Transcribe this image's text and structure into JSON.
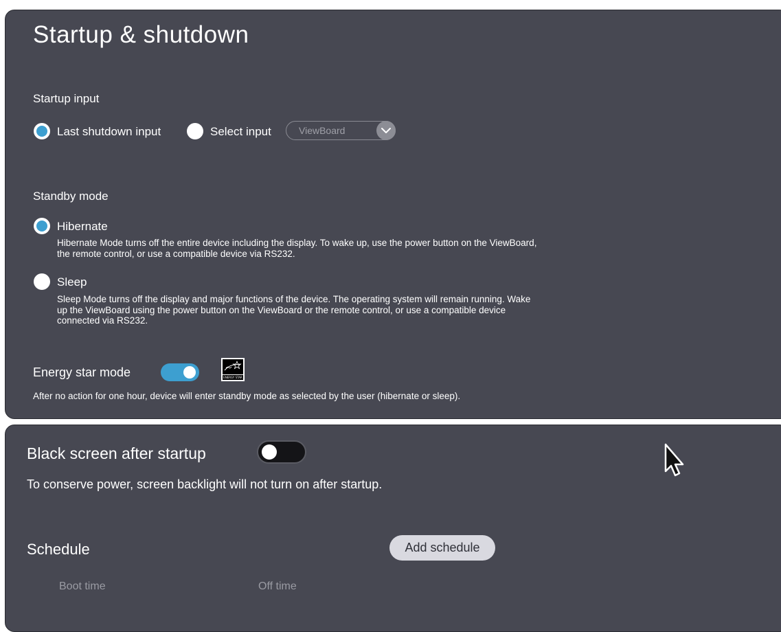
{
  "header": {
    "title": "Startup & shutdown"
  },
  "startup_input": {
    "label": "Startup input",
    "options": [
      {
        "label": "Last shutdown input",
        "selected": true
      },
      {
        "label": "Select input",
        "selected": false
      }
    ],
    "select": {
      "value": "ViewBoard"
    }
  },
  "standby_mode": {
    "label": "Standby mode",
    "options": [
      {
        "label": "Hibernate",
        "selected": true,
        "description": "Hibernate Mode turns off the entire device including the display. To wake up, use the power button on the ViewBoard, the remote control, or use a compatible device via RS232."
      },
      {
        "label": "Sleep",
        "selected": false,
        "description": "Sleep Mode turns off the display and major functions of the device. The operating system will remain running. Wake up the ViewBoard using the power button on the ViewBoard or the remote control, or use a compatible device connected via RS232."
      }
    ]
  },
  "energy_star": {
    "label": "Energy star mode",
    "enabled": true,
    "description": "After no action for one hour, device will enter standby mode as selected by the user (hibernate or sleep).",
    "logo_text": "ENERGY STAR"
  },
  "black_screen": {
    "label": "Black screen after startup",
    "enabled": false,
    "description": "To conserve power, screen backlight will not turn on after startup."
  },
  "schedule": {
    "label": "Schedule",
    "add_button": "Add schedule",
    "columns": [
      "Boot time",
      "Off time"
    ]
  },
  "colors": {
    "panel_bg": "#474852",
    "accent": "#3d9fd0"
  }
}
